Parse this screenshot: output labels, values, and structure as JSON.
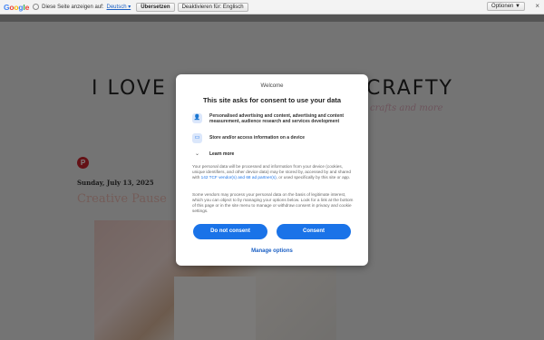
{
  "translate_bar": {
    "logo": [
      "G",
      "o",
      "o",
      "g",
      "l",
      "e"
    ],
    "prompt": "Diese Seite anzeigen auf:",
    "language": "Deutsch ▾",
    "translate_button": "Übersetzen",
    "disable_button": "Deaktivieren für: Englisch",
    "options": "Optionen ▼",
    "close": "×"
  },
  "blog": {
    "title_left": "I LOVE",
    "title_right": "CRAFTY",
    "subtitle": "crafts and more",
    "post_date": "Sunday, July 13, 2025",
    "post_title": "Creative Pause"
  },
  "consent": {
    "welcome": "Welcome",
    "title": "This site asks for consent to use your data",
    "purposes": [
      {
        "icon": "person-icon",
        "glyph": "👤",
        "text": "Personalised advertising and content, advertising and content measurement, audience research and services development"
      },
      {
        "icon": "device-icon",
        "glyph": "▭",
        "text": "Store and/or access information on a device"
      }
    ],
    "learn_more": "Learn more",
    "info_1a": "Your personal data will be processed and information from your device (cookies, unique identifiers, and other device data) may be stored by, accessed by and shared with ",
    "info_1_link": "142 TCF vendor(s) and 68 ad partner(s)",
    "info_1b": ", or used specifically by this site or app.",
    "info_2": "Some vendors may process your personal data on the basis of legitimate interest, which you can object to by managing your options below. Look for a link at the bottom of this page or in the site menu to manage or withdraw consent in privacy and cookie settings.",
    "do_not_consent": "Do not consent",
    "consent": "Consent",
    "manage_options": "Manage options"
  }
}
